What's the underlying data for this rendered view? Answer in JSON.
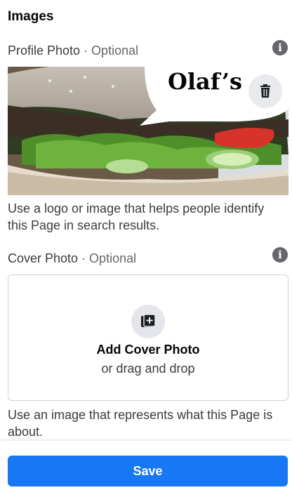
{
  "section": {
    "title": "Images"
  },
  "profile": {
    "label": "Profile Photo",
    "optional": " · Optional",
    "photo_text": "Olaf’s",
    "help": "Use a logo or image that helps people identify this Page in search results."
  },
  "cover": {
    "label": "Cover Photo",
    "optional": " · Optional",
    "add_label": "Add Cover Photo",
    "drag_label": "or drag and drop",
    "help": "Use an image that represents what this Page is about."
  },
  "icons": {
    "info": "info-icon",
    "trash": "trash-icon",
    "add_photo": "add-photo-icon"
  },
  "footer": {
    "save_label": "Save"
  },
  "colors": {
    "primary": "#1877f2",
    "text": "#050505",
    "secondary_text": "#65676b",
    "border": "#ced0d4"
  }
}
